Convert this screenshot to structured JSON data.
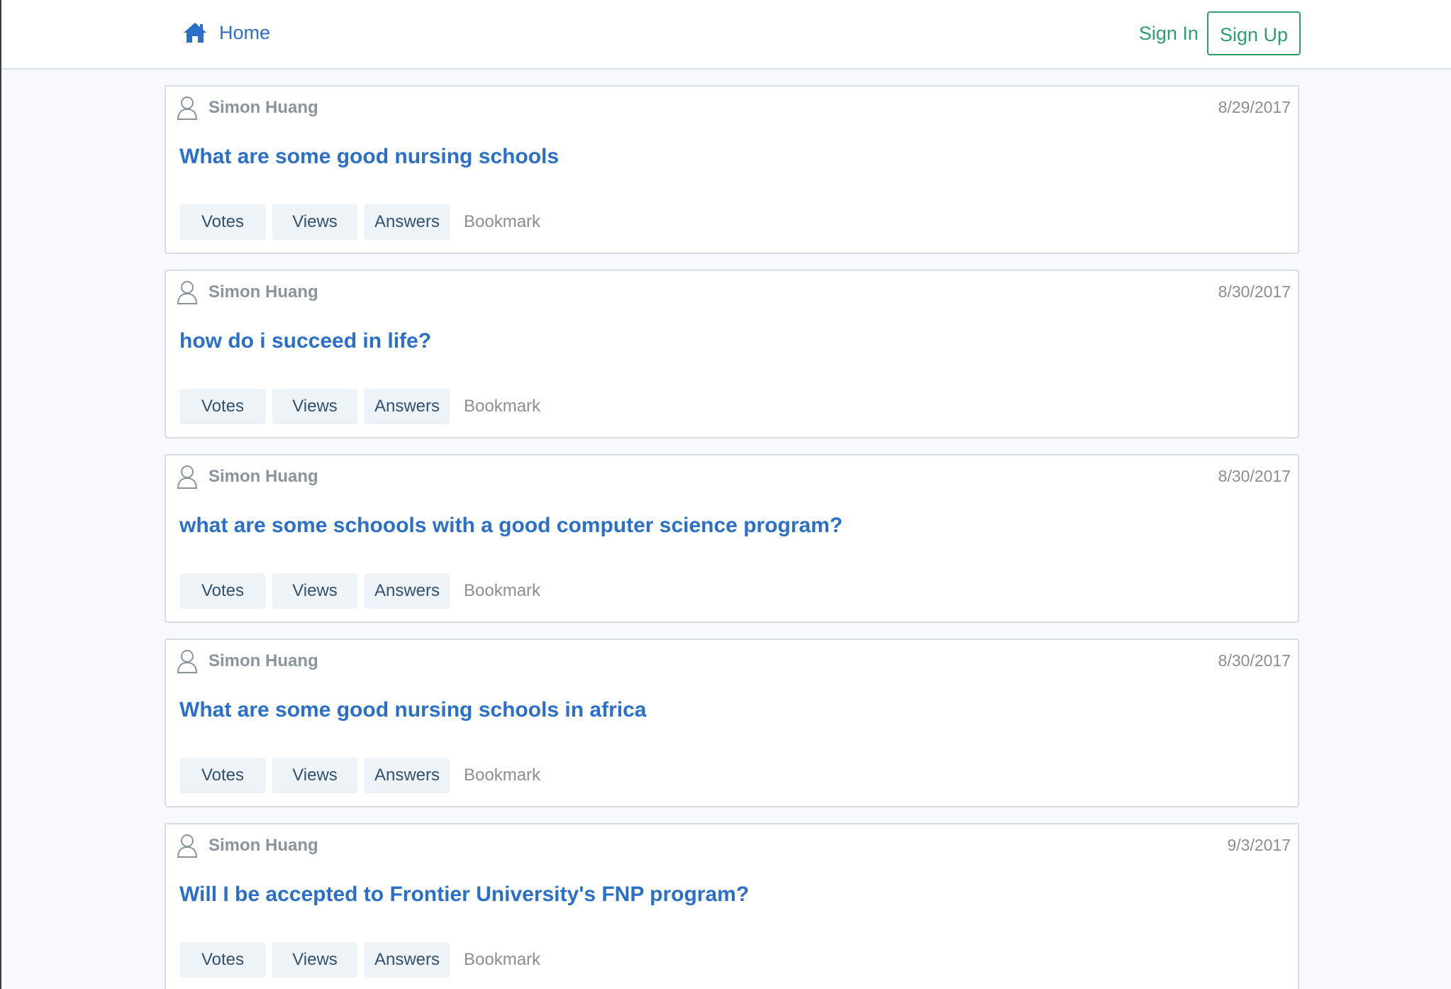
{
  "nav": {
    "home_label": "Home",
    "sign_in_label": "Sign In",
    "sign_up_label": "Sign Up",
    "home_icon": "home-icon"
  },
  "colors": {
    "link_blue": "#2a6fc9",
    "auth_green": "#2e9e6e",
    "muted_gray": "#8a949e",
    "action_bg": "#eef3f8"
  },
  "posts": [
    {
      "author": "Simon Huang",
      "date": "8/29/2017",
      "title": "What are some good nursing schools",
      "actions": {
        "votes": "Votes",
        "views": "Views",
        "answers": "Answers",
        "bookmark": "Bookmark"
      }
    },
    {
      "author": "Simon Huang",
      "date": "8/30/2017",
      "title": "how do i succeed in life?",
      "actions": {
        "votes": "Votes",
        "views": "Views",
        "answers": "Answers",
        "bookmark": "Bookmark"
      }
    },
    {
      "author": "Simon Huang",
      "date": "8/30/2017",
      "title": "what are some schoools with a good computer science program?",
      "actions": {
        "votes": "Votes",
        "views": "Views",
        "answers": "Answers",
        "bookmark": "Bookmark"
      }
    },
    {
      "author": "Simon Huang",
      "date": "8/30/2017",
      "title": "What are some good nursing schools in africa",
      "actions": {
        "votes": "Votes",
        "views": "Views",
        "answers": "Answers",
        "bookmark": "Bookmark"
      }
    },
    {
      "author": "Simon Huang",
      "date": "9/3/2017",
      "title": "Will I be accepted to Frontier University's FNP program?",
      "actions": {
        "votes": "Votes",
        "views": "Views",
        "answers": "Answers",
        "bookmark": "Bookmark"
      }
    }
  ]
}
